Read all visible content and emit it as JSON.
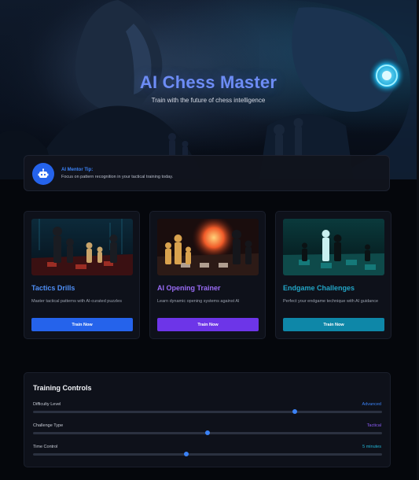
{
  "hero": {
    "title": "AI Chess Master",
    "subtitle": "Train with the future of chess intelligence"
  },
  "tip": {
    "icon": "robot-icon",
    "title": "AI Mentor Tip:",
    "text": "Focus on pattern recognition in your tactical training today."
  },
  "cards": [
    {
      "title": "Tactics Drills",
      "description": "Master tactical patterns with AI-curated puzzles",
      "button": "Train Now",
      "accent": "#4f8ff7",
      "button_color": "#2563eb"
    },
    {
      "title": "AI Opening Trainer",
      "description": "Learn dynamic opening systems against AI",
      "button": "Train Now",
      "accent": "#9a6cf6",
      "button_color": "#6d35e8"
    },
    {
      "title": "Endgame Challenges",
      "description": "Perfect your endgame technique with AI guidance",
      "button": "Train Now",
      "accent": "#22a5c6",
      "button_color": "#0e87a8"
    }
  ],
  "controls": {
    "title": "Training Controls",
    "items": [
      {
        "label": "Difficulty Level",
        "value": "Advanced",
        "level": 0.75,
        "color": "#3b82f6"
      },
      {
        "label": "Challenge Type",
        "value": "Tactical",
        "level": 0.5,
        "color": "#3b82f6"
      },
      {
        "label": "Time Control",
        "value": "5 minutes",
        "level": 0.44,
        "color": "#3b82f6"
      }
    ],
    "value_colors": [
      "#3b82f6",
      "#8b5cf6",
      "#22b5d6"
    ]
  }
}
